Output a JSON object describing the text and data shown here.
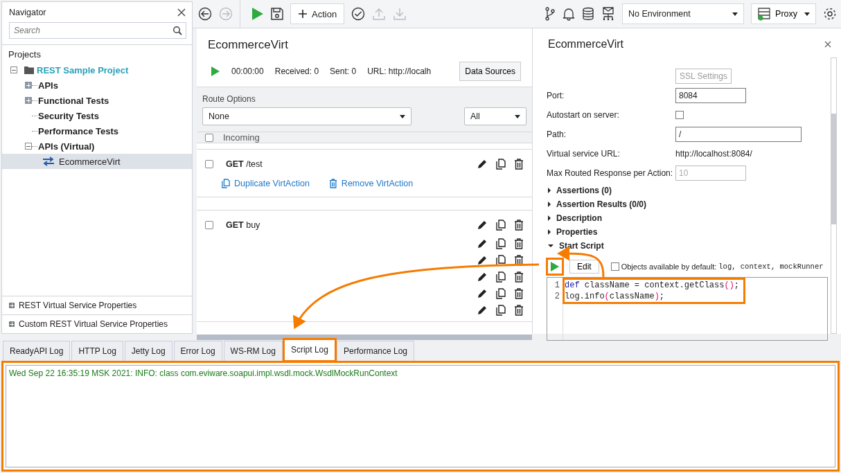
{
  "navigator": {
    "title": "Navigator",
    "search": {
      "placeholder": "Search"
    },
    "root_label": "Projects",
    "tree": [
      {
        "label": "REST Sample Project",
        "expanded": true,
        "selected": false,
        "children": [
          {
            "label": "APIs",
            "kind": "group",
            "expanded": false,
            "selected": false
          },
          {
            "label": "Functional Tests",
            "kind": "group",
            "expanded": false,
            "selected": false
          },
          {
            "label": "Security Tests",
            "kind": "leaf",
            "selected": false
          },
          {
            "label": "Performance Tests",
            "kind": "leaf",
            "selected": false
          },
          {
            "label": "APIs (Virtual)",
            "kind": "group",
            "expanded": true,
            "selected": false,
            "children": [
              {
                "label": "EcommerceVirt",
                "selected": true
              }
            ]
          }
        ]
      }
    ],
    "property_panels": [
      {
        "label": "REST Virtual Service Properties",
        "expanded": false
      },
      {
        "label": "Custom REST Virtual Service Properties",
        "expanded": false
      }
    ]
  },
  "toolbar": {
    "left": [
      {
        "disabled": false
      },
      {
        "disabled": true
      },
      {
        "disabled": false
      },
      {
        "disabled": false
      },
      {
        "label": "Action",
        "disabled": false
      },
      {
        "disabled": false
      },
      {
        "disabled": true
      },
      {
        "disabled": true
      }
    ],
    "environment": "No Environment",
    "proxy": "Proxy"
  },
  "editor": {
    "title": "EcommerceVirt",
    "timer": "00:00:00",
    "received": "Received: 0",
    "sent": "Sent: 0",
    "url": "URL: http://localh",
    "data_sources": "Data Sources",
    "route_options": {
      "label": "Route Options",
      "value": "None"
    },
    "filter": "All",
    "header": {
      "label": "Incoming",
      "checked": false
    },
    "actions": [
      {
        "method": "GET",
        "path": "/test",
        "checked": false,
        "links": [
          "Duplicate VirtAction",
          "Remove VirtAction"
        ]
      },
      {
        "method": "GET",
        "path": "buy",
        "checked": false
      }
    ]
  },
  "inspector": {
    "title": "EcommerceVirt",
    "fields": [
      {
        "kind": "button",
        "value": "SSL Settings",
        "disabled": true
      },
      {
        "kind": "input",
        "label": "Port:",
        "value": "8084",
        "disabled": false
      },
      {
        "kind": "checkbox",
        "label": "Autostart on server:",
        "checked": false
      },
      {
        "kind": "input",
        "label": "Path:",
        "value": "/",
        "disabled": false
      },
      {
        "kind": "static",
        "label": "Virtual service URL:",
        "value": "http://localhost:8084/"
      },
      {
        "kind": "input",
        "label": "Max Routed Response per Action:",
        "value": "10",
        "disabled": true
      }
    ],
    "sections": [
      {
        "label": "Assertions (0)",
        "expanded": false
      },
      {
        "label": "Assertion Results (0/0)",
        "expanded": false
      },
      {
        "label": "Description",
        "expanded": false
      },
      {
        "label": "Properties",
        "expanded": false
      },
      {
        "label": "Start Script",
        "expanded": true
      }
    ],
    "script": {
      "edit": "Edit",
      "objects_checked": false,
      "objects_label": "Objects available by default:",
      "objects": "log, context, mockRunner",
      "lines": [
        {
          "number": "1",
          "tokens": [
            {
              "kind": "keyword",
              "text": "def"
            },
            {
              "kind": "plain",
              "text": " className = context.getClass"
            },
            {
              "kind": "paren",
              "text": "()"
            },
            {
              "kind": "plain",
              "text": ";"
            }
          ]
        },
        {
          "number": "2",
          "tokens": [
            {
              "kind": "plain",
              "text": "log.info"
            },
            {
              "kind": "paren",
              "text": "("
            },
            {
              "kind": "plain",
              "text": "className"
            },
            {
              "kind": "paren",
              "text": ")"
            },
            {
              "kind": "plain",
              "text": ";"
            }
          ]
        }
      ]
    }
  },
  "log": {
    "tabs": [
      {
        "label": "ReadyAPI Log",
        "selected": false
      },
      {
        "label": "HTTP Log",
        "selected": false
      },
      {
        "label": "Jetty Log",
        "selected": false
      },
      {
        "label": "Error Log",
        "selected": false
      },
      {
        "label": "WS-RM Log",
        "selected": false
      },
      {
        "label": "Script Log",
        "selected": true
      },
      {
        "label": "Performance Log",
        "selected": false
      }
    ],
    "lines": [
      "Wed Sep 22 16:35:19 MSK 2021: INFO: class com.eviware.soapui.impl.wsdl.mock.WsdlMockRunContext"
    ]
  }
}
